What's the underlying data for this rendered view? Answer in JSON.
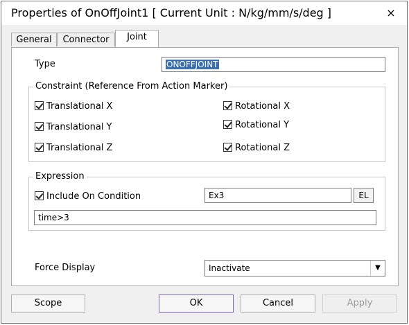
{
  "window": {
    "title": "Properties of OnOffJoint1 [ Current Unit : N/kg/mm/s/deg ]",
    "close_glyph": "×"
  },
  "tabs": [
    {
      "label": "General",
      "active": false
    },
    {
      "label": "Connector",
      "active": false
    },
    {
      "label": "Joint",
      "active": true
    }
  ],
  "joint": {
    "type_label": "Type",
    "type_value": "ONOFFJOINT",
    "constraint": {
      "legend": "Constraint (Reference From Action Marker)",
      "items": [
        {
          "label": "Translational X",
          "checked": true
        },
        {
          "label": "Rotational X",
          "checked": true
        },
        {
          "label": "Translational Y",
          "checked": true
        },
        {
          "label": "Rotational Y",
          "checked": true
        },
        {
          "label": "Translational Z",
          "checked": true
        },
        {
          "label": "Rotational Z",
          "checked": true
        }
      ]
    },
    "expression": {
      "legend": "Expression",
      "include_label": "Include On Condition",
      "include_checked": true,
      "name_value": "Ex3",
      "el_button": "EL",
      "expr_value": "time>3"
    },
    "force_display": {
      "label": "Force Display",
      "selected": "Inactivate",
      "arrow_glyph": "▼"
    }
  },
  "buttons": {
    "scope": "Scope",
    "ok": "OK",
    "cancel": "Cancel",
    "apply": "Apply"
  }
}
